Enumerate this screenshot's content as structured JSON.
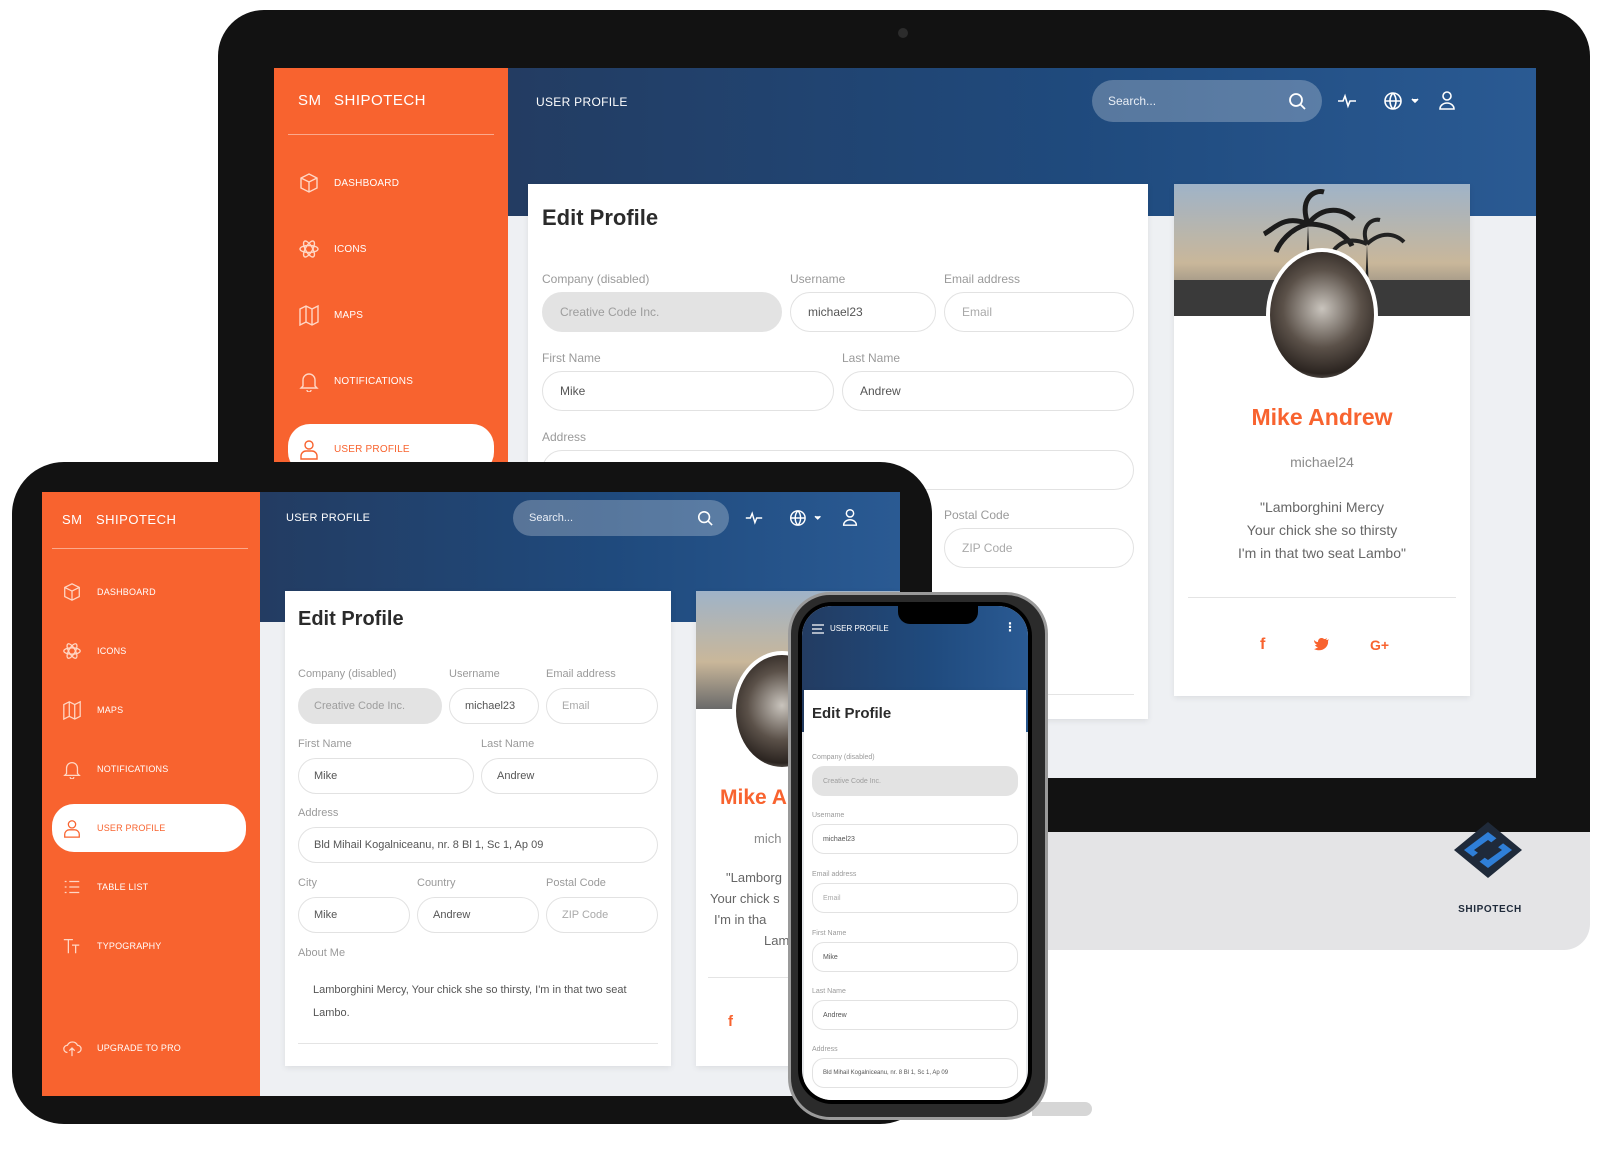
{
  "brand": {
    "short": "SM",
    "name": "SHIPOTECH"
  },
  "page_title": "USER PROFILE",
  "search": {
    "placeholder": "Search..."
  },
  "sidebar": {
    "items": [
      {
        "label": "DASHBOARD",
        "icon": "box-icon"
      },
      {
        "label": "ICONS",
        "icon": "atom-icon"
      },
      {
        "label": "MAPS",
        "icon": "map-icon"
      },
      {
        "label": "NOTIFICATIONS",
        "icon": "bell-icon"
      },
      {
        "label": "USER PROFILE",
        "icon": "user-icon"
      },
      {
        "label": "TABLE LIST",
        "icon": "list-icon"
      },
      {
        "label": "TYPOGRAPHY",
        "icon": "text-icon"
      }
    ],
    "upgrade": "UPGRADE TO PRO"
  },
  "edit_profile": {
    "title": "Edit Profile",
    "company_label": "Company (disabled)",
    "company_value": "Creative Code Inc.",
    "username_label": "Username",
    "username_value": "michael23",
    "email_label": "Email address",
    "email_placeholder": "Email",
    "first_name_label": "First Name",
    "first_name_value": "Mike",
    "last_name_label": "Last Name",
    "last_name_value": "Andrew",
    "address_label": "Address",
    "address_value": "Bld Mihail Kogalniceanu, nr. 8 Bl 1, Sc 1, Ap 09",
    "city_label": "City",
    "city_value": "Mike",
    "country_label": "Country",
    "country_value": "Andrew",
    "postal_label": "Postal Code",
    "postal_placeholder": "ZIP Code",
    "about_label": "About Me",
    "about_value": "Lamborghini Mercy, Your chick she so thirsty, I'm in that two seat Lambo."
  },
  "profile_card": {
    "name": "Mike Andrew",
    "handle": "michael24",
    "quote_line1": "\"Lamborghini Mercy",
    "quote_line2": "Your chick she so thirsty",
    "quote_line3": "I'm in that two seat Lambo\"",
    "tablet_name_partial": "Mike A",
    "tablet_handle_partial": "mich",
    "tablet_quote1_partial": "\"Lamborg",
    "tablet_quote2_partial": "Your chick s",
    "tablet_quote3_partial": "I'm in tha",
    "tablet_quote4_partial": "Lam",
    "social": [
      "f",
      "t",
      "G+"
    ]
  },
  "phone_menu_icon": "⋮",
  "logo": {
    "text": "SHIPOTECH"
  }
}
